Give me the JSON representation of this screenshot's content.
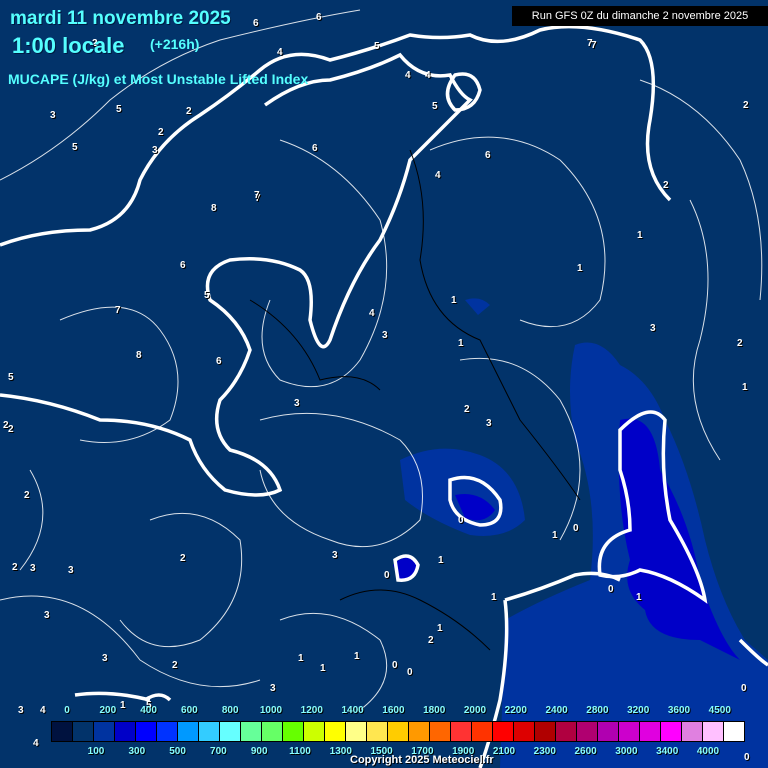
{
  "header": {
    "date": "mardi 11 novembre 2025",
    "time": "1:00 locale",
    "lead": "(+216h)",
    "title": "MUCAPE (J/kg) et Most Unstable Lifted Index",
    "run": "Run GFS 0Z du dimanche 2 novembre 2025"
  },
  "legend": {
    "labels_top": [
      "0",
      "200",
      "400",
      "600",
      "800",
      "1000",
      "1200",
      "1400",
      "1600",
      "1800",
      "2000",
      "2200",
      "2400",
      "2800",
      "3200",
      "3600",
      "4500"
    ],
    "labels_bottom": [
      "100",
      "300",
      "500",
      "700",
      "900",
      "1100",
      "1300",
      "1500",
      "1700",
      "1900",
      "2100",
      "2300",
      "2600",
      "3000",
      "3400",
      "4000"
    ],
    "colors": [
      "#00123f",
      "#02336a",
      "#0033a0",
      "#0000c8",
      "#0000ff",
      "#0033ff",
      "#0099ff",
      "#33ccff",
      "#66ffff",
      "#66ff99",
      "#66ff66",
      "#66ff00",
      "#ccff00",
      "#ffff00",
      "#ffff88",
      "#ffe650",
      "#ffcc00",
      "#ff9900",
      "#ff6600",
      "#ff3333",
      "#ff3300",
      "#ff0000",
      "#dd0000",
      "#b00000",
      "#b00040",
      "#b00070",
      "#b000b0",
      "#cc00cc",
      "#e000e0",
      "#ff00ff",
      "#e080e0",
      "#ffc0ff",
      "#ffffff"
    ]
  },
  "contour_labels": [
    "6",
    "6",
    "4",
    "5",
    "4",
    "4",
    "5",
    "7",
    "2",
    "3",
    "5",
    "2",
    "2",
    "5",
    "6",
    "8",
    "7",
    "4",
    "3",
    "6",
    "5",
    "7",
    "8",
    "6",
    "3",
    "4",
    "1",
    "3",
    "1",
    "2",
    "3",
    "5",
    "2",
    "3",
    "2",
    "3",
    "3",
    "1",
    "0",
    "1",
    "0",
    "0",
    "1",
    "1",
    "2",
    "1",
    "1",
    "0",
    "1",
    "2",
    "1",
    "0",
    "3",
    "2",
    "2",
    "2",
    "3",
    "4",
    "3",
    "5",
    "2",
    "1",
    "3",
    "7",
    "2",
    "1",
    "1",
    "0",
    "0",
    "0",
    "1",
    "3",
    "2",
    "4",
    "6",
    "7"
  ],
  "copyright": "Copyright 2025 Meteociel.fr",
  "colors": {
    "background": "#02336a",
    "title": "#55ffff"
  }
}
